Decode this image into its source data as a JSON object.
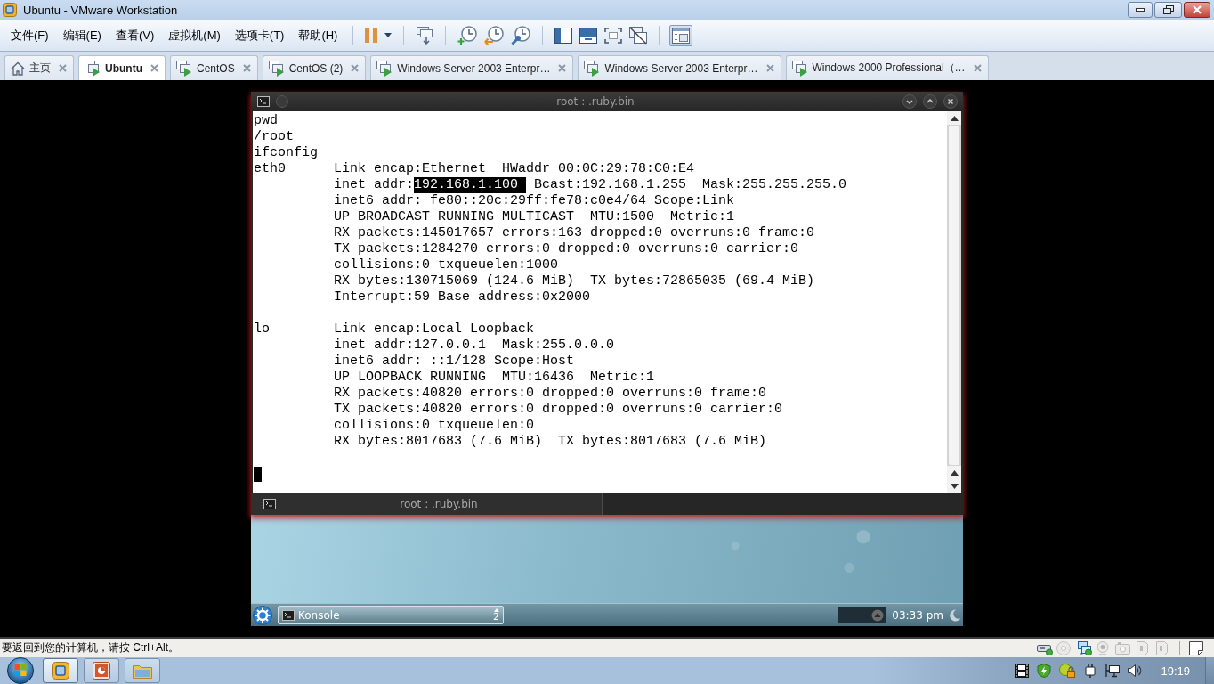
{
  "window": {
    "title": "Ubuntu - VMware Workstation"
  },
  "menu": [
    "文件(F)",
    "编辑(E)",
    "查看(V)",
    "虚拟机(M)",
    "选项卡(T)",
    "帮助(H)"
  ],
  "toolbar": {
    "console_view": {
      "pressed": true
    }
  },
  "tabs": [
    {
      "label": "主页",
      "kind": "home",
      "selected": false
    },
    {
      "label": "Ubuntu",
      "kind": "vm",
      "selected": true
    },
    {
      "label": "CentOS",
      "kind": "vm",
      "selected": false
    },
    {
      "label": "CentOS (2)",
      "kind": "vm",
      "selected": false
    },
    {
      "label": "Windows Server 2003 Enterpr…",
      "kind": "vm",
      "selected": false
    },
    {
      "label": "Windows Server 2003 Enterpr…",
      "kind": "vm",
      "selected": false
    },
    {
      "label": "Windows 2000 Professional（…",
      "kind": "vm",
      "selected": false
    }
  ],
  "guest": {
    "konsole": {
      "title": "root : .ruby.bin",
      "output": [
        {
          "kind": "text",
          "text": "pwd"
        },
        {
          "kind": "text",
          "text": "/root"
        },
        {
          "kind": "text",
          "text": "ifconfig"
        },
        {
          "kind": "interface",
          "name": "eth0",
          "lines": [
            {
              "text": "Link encap:Ethernet  HWaddr 00:0C:29:78:C0:E4"
            },
            {
              "segments": [
                {
                  "text": "inet addr:",
                  "selected": false
                },
                {
                  "text": "192.168.1.100 ",
                  "selected": true
                },
                {
                  "text": " Bcast:192.168.1.255  Mask:255.255.255.0",
                  "selected": false
                }
              ]
            },
            {
              "text": "inet6 addr: fe80::20c:29ff:fe78:c0e4/64 Scope:Link"
            },
            {
              "text": "UP BROADCAST RUNNING MULTICAST  MTU:1500  Metric:1"
            },
            {
              "text": "RX packets:145017657 errors:163 dropped:0 overruns:0 frame:0"
            },
            {
              "text": "TX packets:1284270 errors:0 dropped:0 overruns:0 carrier:0"
            },
            {
              "text": "collisions:0 txqueuelen:1000"
            },
            {
              "text": "RX bytes:130715069 (124.6 MiB)  TX bytes:72865035 (69.4 MiB)"
            },
            {
              "text": "Interrupt:59 Base address:0x2000"
            }
          ]
        },
        {
          "kind": "interface",
          "name": "lo",
          "lines": [
            {
              "text": "Link encap:Local Loopback"
            },
            {
              "text": "inet addr:127.0.0.1  Mask:255.0.0.0"
            },
            {
              "text": "inet6 addr: ::1/128 Scope:Host"
            },
            {
              "text": "UP LOOPBACK RUNNING  MTU:16436  Metric:1"
            },
            {
              "text": "RX packets:40820 errors:0 dropped:0 overruns:0 frame:0"
            },
            {
              "text": "TX packets:40820 errors:0 dropped:0 overruns:0 carrier:0"
            },
            {
              "text": "collisions:0 txqueuelen:0"
            },
            {
              "text": "RX bytes:8017683 (7.6 MiB)  TX bytes:8017683 (7.6 MiB)"
            }
          ]
        }
      ],
      "cursor": true,
      "tabs": [
        {
          "label": "root : .ruby.bin",
          "selected": true
        }
      ]
    },
    "panel": {
      "tasks": [
        {
          "label": "Konsole",
          "count": "2",
          "active": true
        }
      ],
      "clock": "03:33 pm"
    }
  },
  "status_bar": {
    "message": "要返回到您的计算机，请按 Ctrl+Alt。",
    "devices": [
      {
        "kind": "disk",
        "connected": true
      },
      {
        "kind": "disc",
        "connected": false
      },
      {
        "kind": "network",
        "connected": true
      },
      {
        "kind": "webcam",
        "connected": false
      },
      {
        "kind": "camera",
        "connected": false
      },
      {
        "kind": "port",
        "connected": false
      },
      {
        "kind": "port",
        "connected": false
      }
    ]
  },
  "taskbar": {
    "apps": [
      {
        "kind": "workstation",
        "active": true
      },
      {
        "kind": "slides",
        "active": false
      },
      {
        "kind": "folder",
        "active": false
      }
    ],
    "clock": "19:19"
  }
}
